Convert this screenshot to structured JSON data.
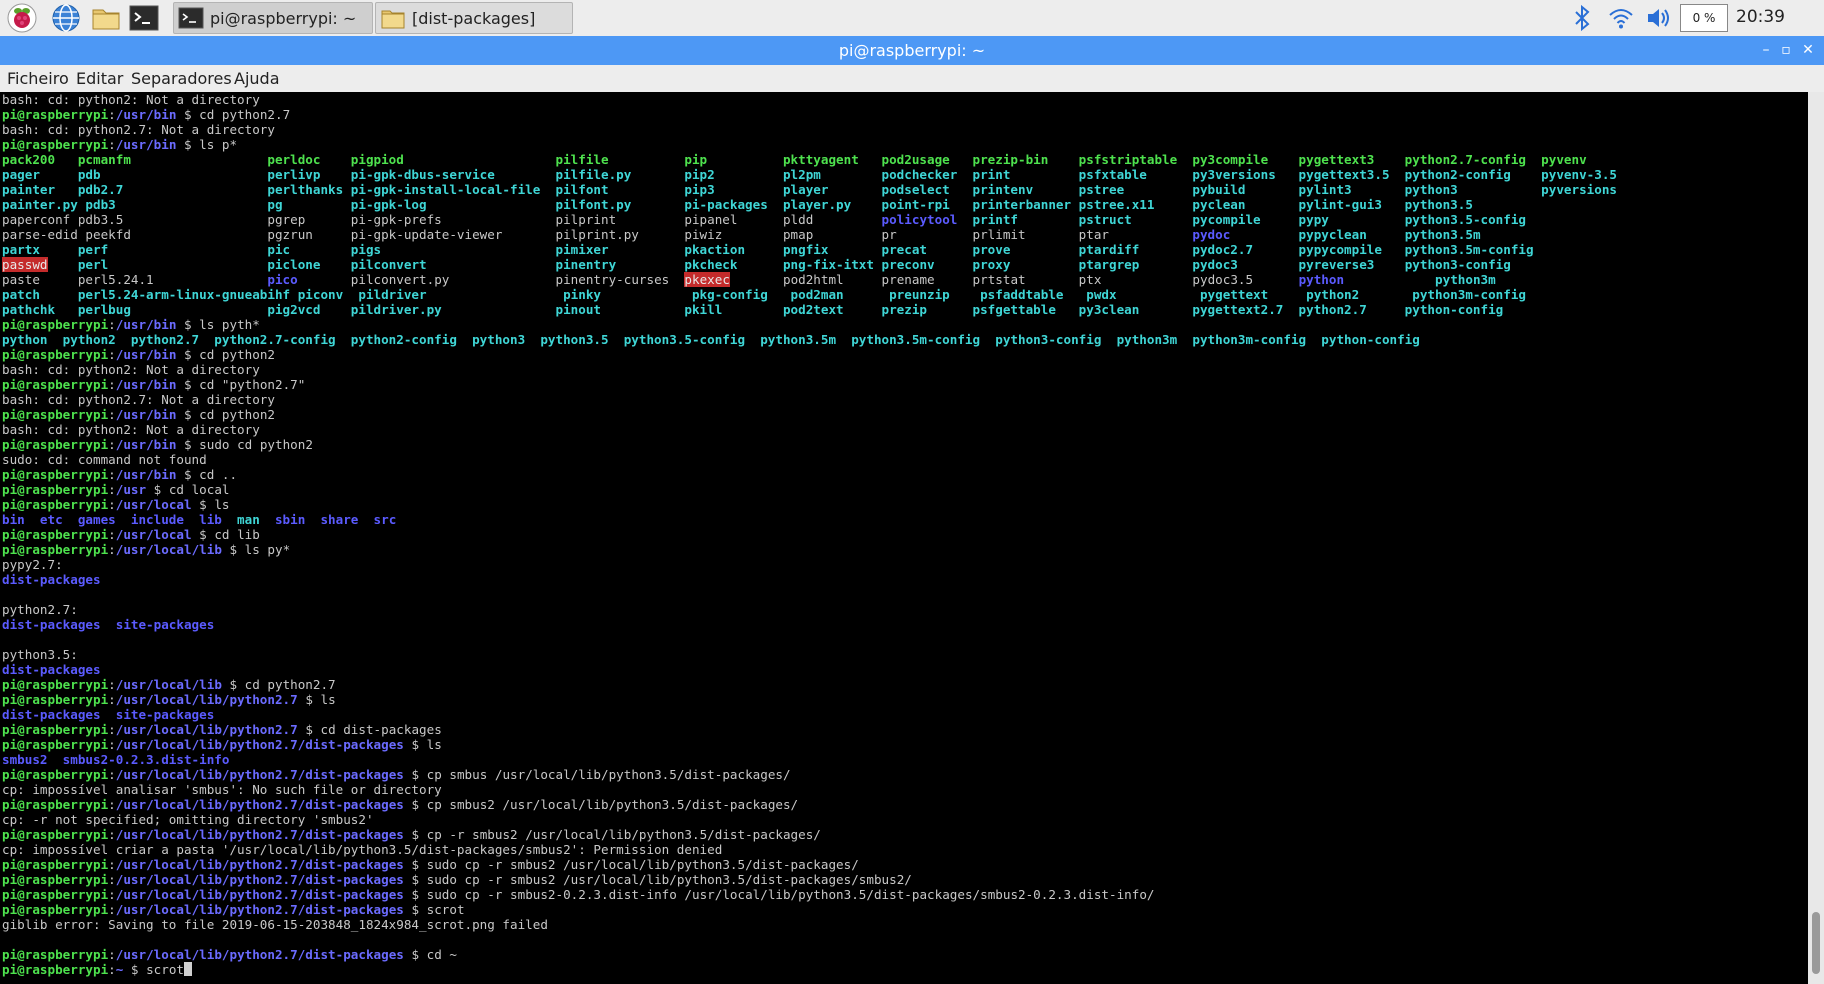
{
  "taskbar": {
    "tasks": [
      {
        "label": "pi@raspberrypi: ~"
      },
      {
        "label": "[dist-packages]"
      }
    ],
    "cpu": "0 %",
    "clock": "20:39"
  },
  "window": {
    "title": "pi@raspberrypi: ~",
    "min": "–",
    "max": "▫",
    "close": "✕"
  },
  "menu": [
    "Ficheiro",
    "Editar",
    "Separadores",
    "Ajuda"
  ],
  "terminal": {
    "lines": [
      [
        {
          "t": "bash: cd: python2: Not a directory"
        }
      ],
      [
        {
          "t": "pi@raspberrypi",
          "c": "u"
        },
        {
          "t": ":"
        },
        {
          "t": "/usr/bin",
          "c": "p"
        },
        {
          "t": " $ cd python2.7"
        }
      ],
      [
        {
          "t": "bash: cd: python2.7: Not a directory"
        }
      ],
      [
        {
          "t": "pi@raspberrypi",
          "c": "u"
        },
        {
          "t": ":"
        },
        {
          "t": "/usr/bin",
          "c": "p"
        },
        {
          "t": " $ ls p*"
        }
      ],
      [
        {
          "t": "pack200   pcmanfm                  perldoc    pigpiod                    pilfile          pip          pkttyagent   pod2usage   prezip-bin    psfstriptable  py3compile    pygettext3    python2.7-config  pyvenv",
          "c": "g"
        }
      ],
      [
        {
          "t": "pager     pdb                      perlivp    pi-gpk-dbus-service        pilfile.py       pip2         pl2pm        podchecker  print         psfxtable      py3versions   pygettext3.5  python2-config    pyvenv-3.5",
          "c": "c"
        }
      ],
      [
        {
          "t": "painter   pdb2.7                   perlthanks pi-gpk-install-local-file  pilfont          pip3         player       podselect   printenv      pstree         pybuild       pylint3       python3           pyversions",
          "c": "c"
        }
      ],
      [
        {
          "t": "painter.py pdb3                    pg         pi-gpk-log                 pilfont.py       pi-packages  player.py    point-rpi   printerbanner pstree.x11     pyclean       pylint-gui3   python3.5",
          "c": "c"
        }
      ],
      [
        {
          "t": "paperconf pdb3.5                   pgrep      pi-gpk-prefs               pilprint         pipanel      pldd         "
        },
        {
          "t": "policytool",
          "c": "b"
        },
        {
          "t": "  printf        pstruct        pycompile     pypy          python3.5-config",
          "c": "c"
        }
      ],
      [
        {
          "t": "parse-edid peekfd                  pgzrun     pi-gpk-update-viewer       pilprint.py      piwiz        pmap         pr          prlimit       ptar           "
        },
        {
          "t": "pydoc",
          "c": "b"
        },
        {
          "t": "         pypyclean     python3.5m",
          "c": "c"
        }
      ],
      [
        {
          "t": "partx     perf                     pic        pigs                       pimixer          pkaction     pngfix       precat      prove         ptardiff       pydoc2.7      pypycompile   python3.5m-config",
          "c": "c"
        }
      ],
      [
        {
          "t": "passwd",
          "c": "r"
        },
        {
          "t": "    perl                     piclone    pilconvert                 pinentry         pkcheck      png-fix-itxt preconv     proxy         ptargrep       pydoc3        pyreverse3    python3-config",
          "c": "c"
        }
      ],
      [
        {
          "t": "paste     perl5.24.1               "
        },
        {
          "t": "pico",
          "c": "b"
        },
        {
          "t": "       pilconvert.py              pinentry-curses  "
        },
        {
          "t": "pkexec",
          "c": "r"
        },
        {
          "t": "       pod2html     prename     prtstat       ptx            pydoc3.5      "
        },
        {
          "t": "python",
          "c": "b"
        },
        {
          "t": "            python3m",
          "c": "c"
        }
      ],
      [
        {
          "t": "patch     perl5.24-arm-linux-gnueabihf piconv  pildriver                  pinky            pkg-config   pod2man      preunzip    psfaddtable   pwdx           pygettext     python2       python3m-config",
          "c": "c"
        }
      ],
      [
        {
          "t": "pathchk   perlbug                  pig2vcd    pildriver.py               pinout           pkill        pod2text     prezip      psfgettable   py3clean       pygettext2.7  python2.7     python-config",
          "c": "c"
        }
      ],
      [
        {
          "t": "pi@raspberrypi",
          "c": "u"
        },
        {
          "t": ":"
        },
        {
          "t": "/usr/bin",
          "c": "p"
        },
        {
          "t": " $ ls pyth*"
        }
      ],
      [
        {
          "t": "python  python2  python2.7  python2.7-config  python2-config  python3  python3.5  python3.5-config  python3.5m  python3.5m-config  python3-config  python3m  python3m-config  python-config",
          "c": "c"
        }
      ],
      [
        {
          "t": "pi@raspberrypi",
          "c": "u"
        },
        {
          "t": ":"
        },
        {
          "t": "/usr/bin",
          "c": "p"
        },
        {
          "t": " $ cd python2"
        }
      ],
      [
        {
          "t": "bash: cd: python2: Not a directory"
        }
      ],
      [
        {
          "t": "pi@raspberrypi",
          "c": "u"
        },
        {
          "t": ":"
        },
        {
          "t": "/usr/bin",
          "c": "p"
        },
        {
          "t": " $ cd \"python2.7\""
        }
      ],
      [
        {
          "t": "bash: cd: python2.7: Not a directory"
        }
      ],
      [
        {
          "t": "pi@raspberrypi",
          "c": "u"
        },
        {
          "t": ":"
        },
        {
          "t": "/usr/bin",
          "c": "p"
        },
        {
          "t": " $ cd python2"
        }
      ],
      [
        {
          "t": "bash: cd: python2: Not a directory"
        }
      ],
      [
        {
          "t": "pi@raspberrypi",
          "c": "u"
        },
        {
          "t": ":"
        },
        {
          "t": "/usr/bin",
          "c": "p"
        },
        {
          "t": " $ sudo cd python2"
        }
      ],
      [
        {
          "t": "sudo: cd: command not found"
        }
      ],
      [
        {
          "t": "pi@raspberrypi",
          "c": "u"
        },
        {
          "t": ":"
        },
        {
          "t": "/usr/bin",
          "c": "p"
        },
        {
          "t": " $ cd .."
        }
      ],
      [
        {
          "t": "pi@raspberrypi",
          "c": "u"
        },
        {
          "t": ":"
        },
        {
          "t": "/usr",
          "c": "p"
        },
        {
          "t": " $ cd local"
        }
      ],
      [
        {
          "t": "pi@raspberrypi",
          "c": "u"
        },
        {
          "t": ":"
        },
        {
          "t": "/usr/local",
          "c": "p"
        },
        {
          "t": " $ ls"
        }
      ],
      [
        {
          "t": "bin  etc  games  include  lib  ",
          "c": "b"
        },
        {
          "t": "man",
          "c": "c"
        },
        {
          "t": "  sbin  share  src",
          "c": "b"
        }
      ],
      [
        {
          "t": "pi@raspberrypi",
          "c": "u"
        },
        {
          "t": ":"
        },
        {
          "t": "/usr/local",
          "c": "p"
        },
        {
          "t": " $ cd lib"
        }
      ],
      [
        {
          "t": "pi@raspberrypi",
          "c": "u"
        },
        {
          "t": ":"
        },
        {
          "t": "/usr/local/lib",
          "c": "p"
        },
        {
          "t": " $ ls py*"
        }
      ],
      [
        {
          "t": "pypy2.7:"
        }
      ],
      [
        {
          "t": "dist-packages",
          "c": "b"
        }
      ],
      [
        {
          "t": ""
        }
      ],
      [
        {
          "t": "python2.7:"
        }
      ],
      [
        {
          "t": "dist-packages  site-packages",
          "c": "b"
        }
      ],
      [
        {
          "t": ""
        }
      ],
      [
        {
          "t": "python3.5:"
        }
      ],
      [
        {
          "t": "dist-packages",
          "c": "b"
        }
      ],
      [
        {
          "t": "pi@raspberrypi",
          "c": "u"
        },
        {
          "t": ":"
        },
        {
          "t": "/usr/local/lib",
          "c": "p"
        },
        {
          "t": " $ cd python2.7"
        }
      ],
      [
        {
          "t": "pi@raspberrypi",
          "c": "u"
        },
        {
          "t": ":"
        },
        {
          "t": "/usr/local/lib/python2.7",
          "c": "p"
        },
        {
          "t": " $ ls"
        }
      ],
      [
        {
          "t": "dist-packages  site-packages",
          "c": "b"
        }
      ],
      [
        {
          "t": "pi@raspberrypi",
          "c": "u"
        },
        {
          "t": ":"
        },
        {
          "t": "/usr/local/lib/python2.7",
          "c": "p"
        },
        {
          "t": " $ cd dist-packages"
        }
      ],
      [
        {
          "t": "pi@raspberrypi",
          "c": "u"
        },
        {
          "t": ":"
        },
        {
          "t": "/usr/local/lib/python2.7/dist-packages",
          "c": "p"
        },
        {
          "t": " $ ls"
        }
      ],
      [
        {
          "t": "smbus2  smbus2-0.2.3.dist-info",
          "c": "b"
        }
      ],
      [
        {
          "t": "pi@raspberrypi",
          "c": "u"
        },
        {
          "t": ":"
        },
        {
          "t": "/usr/local/lib/python2.7/dist-packages",
          "c": "p"
        },
        {
          "t": " $ cp smbus /usr/local/lib/python3.5/dist-packages/"
        }
      ],
      [
        {
          "t": "cp: impossível analisar 'smbus': No such file or directory"
        }
      ],
      [
        {
          "t": "pi@raspberrypi",
          "c": "u"
        },
        {
          "t": ":"
        },
        {
          "t": "/usr/local/lib/python2.7/dist-packages",
          "c": "p"
        },
        {
          "t": " $ cp smbus2 /usr/local/lib/python3.5/dist-packages/"
        }
      ],
      [
        {
          "t": "cp: -r not specified; omitting directory 'smbus2'"
        }
      ],
      [
        {
          "t": "pi@raspberrypi",
          "c": "u"
        },
        {
          "t": ":"
        },
        {
          "t": "/usr/local/lib/python2.7/dist-packages",
          "c": "p"
        },
        {
          "t": " $ cp -r smbus2 /usr/local/lib/python3.5/dist-packages/"
        }
      ],
      [
        {
          "t": "cp: impossível criar a pasta '/usr/local/lib/python3.5/dist-packages/smbus2': Permission denied"
        }
      ],
      [
        {
          "t": "pi@raspberrypi",
          "c": "u"
        },
        {
          "t": ":"
        },
        {
          "t": "/usr/local/lib/python2.7/dist-packages",
          "c": "p"
        },
        {
          "t": " $ sudo cp -r smbus2 /usr/local/lib/python3.5/dist-packages/"
        }
      ],
      [
        {
          "t": "pi@raspberrypi",
          "c": "u"
        },
        {
          "t": ":"
        },
        {
          "t": "/usr/local/lib/python2.7/dist-packages",
          "c": "p"
        },
        {
          "t": " $ sudo cp -r smbus2 /usr/local/lib/python3.5/dist-packages/smbus2/"
        }
      ],
      [
        {
          "t": "pi@raspberrypi",
          "c": "u"
        },
        {
          "t": ":"
        },
        {
          "t": "/usr/local/lib/python2.7/dist-packages",
          "c": "p"
        },
        {
          "t": " $ sudo cp -r smbus2-0.2.3.dist-info /usr/local/lib/python3.5/dist-packages/smbus2-0.2.3.dist-info/"
        }
      ],
      [
        {
          "t": "pi@raspberrypi",
          "c": "u"
        },
        {
          "t": ":"
        },
        {
          "t": "/usr/local/lib/python2.7/dist-packages",
          "c": "p"
        },
        {
          "t": " $ scrot"
        }
      ],
      [
        {
          "t": "giblib error: Saving to file 2019-06-15-203848_1824x984_scrot.png failed"
        }
      ],
      [
        {
          "t": ""
        }
      ],
      [
        {
          "t": "pi@raspberrypi",
          "c": "u"
        },
        {
          "t": ":"
        },
        {
          "t": "/usr/local/lib/python2.7/dist-packages",
          "c": "p"
        },
        {
          "t": " $ cd ~"
        }
      ],
      [
        {
          "t": "pi@raspberrypi",
          "c": "u"
        },
        {
          "t": ":"
        },
        {
          "t": "~",
          "c": "p"
        },
        {
          "t": " $ scrot"
        }
      ]
    ]
  }
}
